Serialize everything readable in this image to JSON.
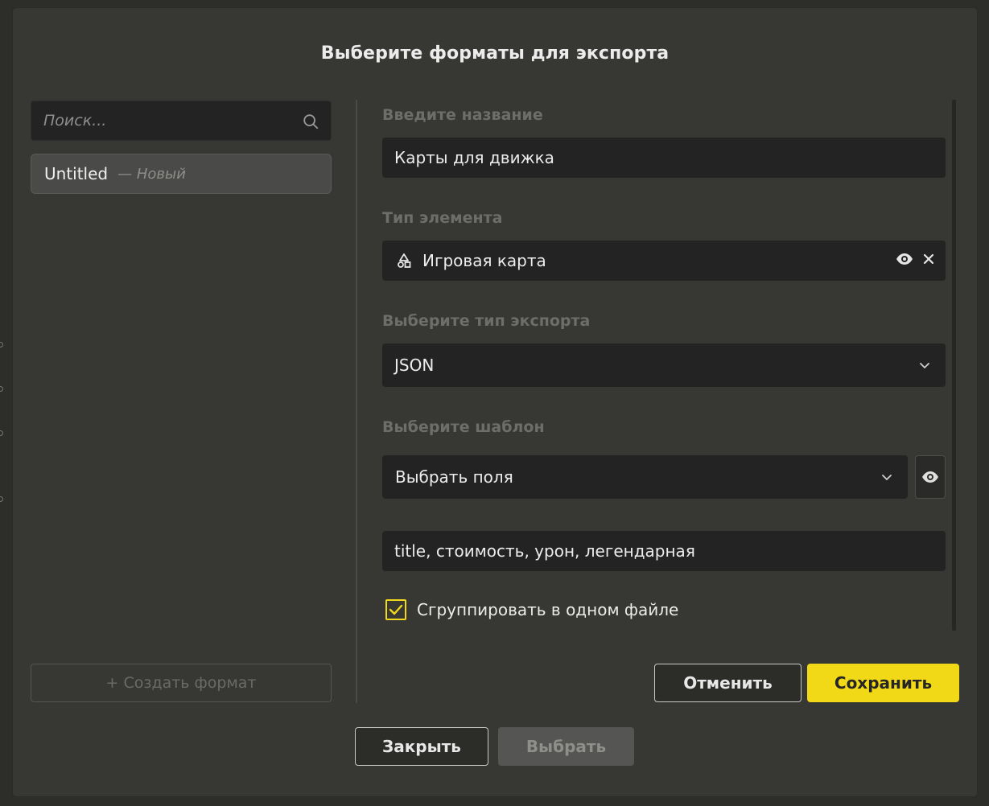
{
  "dialog": {
    "title": "Выберите форматы для экспорта"
  },
  "sidebar": {
    "search_placeholder": "Поиск...",
    "items": [
      {
        "label": "Untitled",
        "status": "— Новый"
      }
    ],
    "create_label": "+ Создать формат"
  },
  "form": {
    "name_label": "Введите название",
    "name_value": "Карты для движка",
    "type_label": "Тип элемента",
    "type_value": "Игровая карта",
    "export_label": "Выберите тип экспорта",
    "export_value": "JSON",
    "template_label": "Выберите шаблон",
    "template_value": "Выбрать поля",
    "fields_value": "title, стоимость, урон, легендарная",
    "group_label": "Сгруппировать в одном файле",
    "group_checked": true,
    "cancel_label": "Отменить",
    "save_label": "Сохранить"
  },
  "footer": {
    "close_label": "Закрыть",
    "choose_label": "Выбрать"
  },
  "colors": {
    "accent": "#f2d918",
    "dialog_bg": "#373733",
    "field_bg": "#232323"
  },
  "icons": {
    "search": "search-icon",
    "element_type": "shapes-icon",
    "view": "eye-icon",
    "clear": "close-icon",
    "dropdown": "chevron-down-icon",
    "check": "checkmark-icon"
  }
}
